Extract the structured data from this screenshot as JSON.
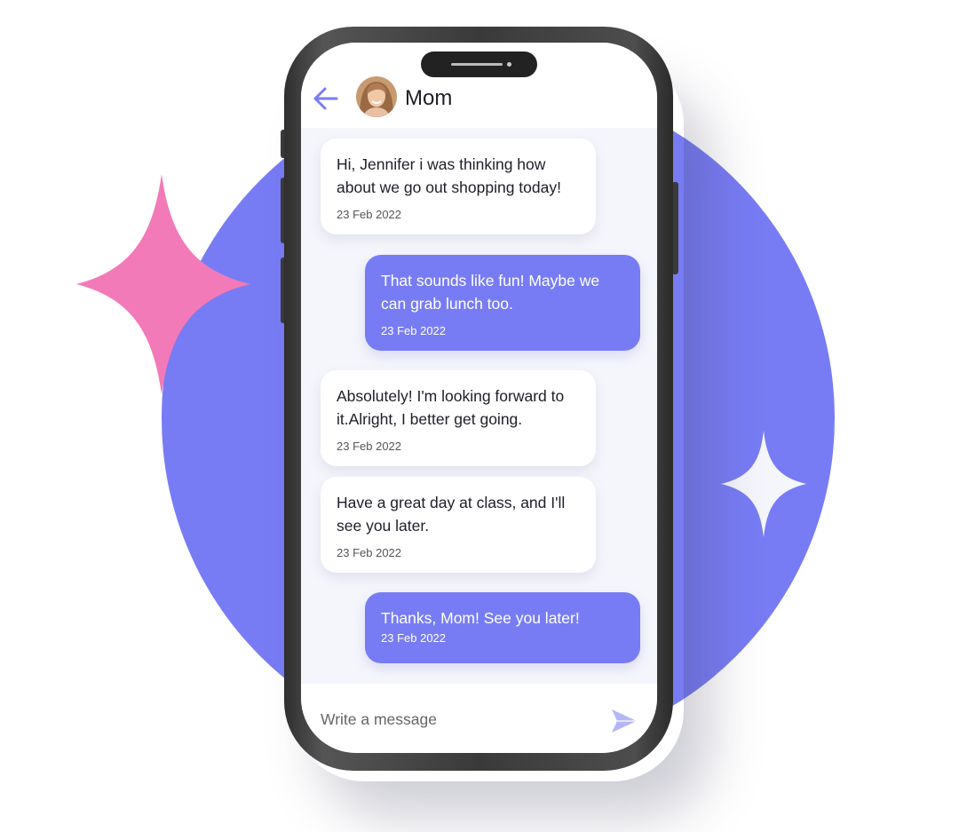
{
  "header": {
    "back_icon": "arrow-left-icon",
    "contact_name": "Mom"
  },
  "messages": [
    {
      "direction": "incoming",
      "text": "Hi, Jennifer i was thinking how about we go out shopping today!",
      "date": "23 Feb 2022"
    },
    {
      "direction": "outgoing",
      "text": "That sounds like fun! Maybe we can grab lunch too.",
      "date": "23 Feb 2022"
    },
    {
      "direction": "incoming",
      "text": "Absolutely! I'm looking forward to it.Alright, I better get going.",
      "date": "23 Feb 2022"
    },
    {
      "direction": "incoming",
      "text": "Have a great day at class, and I'll see you later.",
      "date": "23 Feb 2022"
    },
    {
      "direction": "outgoing",
      "text": "Thanks, Mom! See you later!",
      "date": "23 Feb 2022"
    }
  ],
  "composer": {
    "placeholder": "Write a message",
    "send_icon": "send-icon"
  },
  "colors": {
    "accent": "#787cf4",
    "sparkle_pink": "#f27ab8",
    "sparkle_white": "#f5f6fc",
    "screen_bg": "#f5f6fc"
  }
}
